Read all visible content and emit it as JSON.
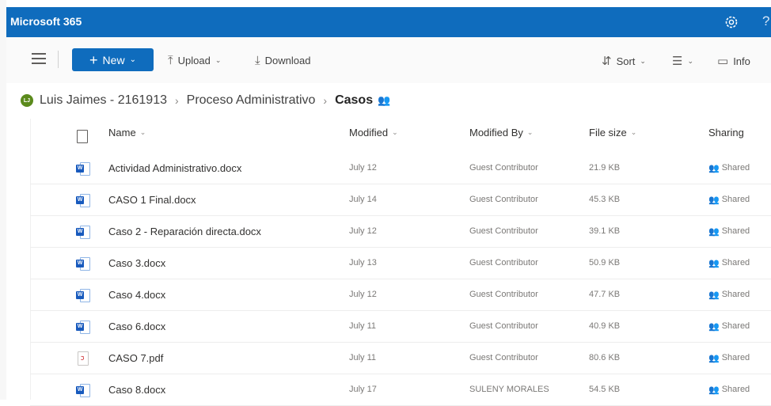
{
  "app": {
    "title": "Microsoft 365"
  },
  "toolbar": {
    "new_label": "New",
    "upload_label": "Upload",
    "download_label": "Download",
    "sort_label": "Sort",
    "info_label": "Info"
  },
  "breadcrumb": {
    "avatar_initials": "LJ",
    "items": [
      "Luis Jaimes - 2161913",
      "Proceso Administrativo",
      "Casos"
    ]
  },
  "columns": {
    "name": "Name",
    "modified": "Modified",
    "modified_by": "Modified By",
    "file_size": "File size",
    "sharing": "Sharing"
  },
  "files": [
    {
      "name": "Actividad Administrativo.docx",
      "modified": "July 12",
      "modified_by": "Guest Contributor",
      "size": "21.9 KB",
      "sharing": "Shared",
      "type": "docx"
    },
    {
      "name": "CASO 1 Final.docx",
      "modified": "July 14",
      "modified_by": "Guest Contributor",
      "size": "45.3 KB",
      "sharing": "Shared",
      "type": "docx"
    },
    {
      "name": "Caso 2 - Reparación directa.docx",
      "modified": "July 12",
      "modified_by": "Guest Contributor",
      "size": "39.1 KB",
      "sharing": "Shared",
      "type": "docx"
    },
    {
      "name": "Caso 3.docx",
      "modified": "July 13",
      "modified_by": "Guest Contributor",
      "size": "50.9 KB",
      "sharing": "Shared",
      "type": "docx"
    },
    {
      "name": "Caso 4.docx",
      "modified": "July 12",
      "modified_by": "Guest Contributor",
      "size": "47.7 KB",
      "sharing": "Shared",
      "type": "docx"
    },
    {
      "name": "Caso 6.docx",
      "modified": "July 11",
      "modified_by": "Guest Contributor",
      "size": "40.9 KB",
      "sharing": "Shared",
      "type": "docx"
    },
    {
      "name": "CASO 7.pdf",
      "modified": "July 11",
      "modified_by": "Guest Contributor",
      "size": "80.6 KB",
      "sharing": "Shared",
      "type": "pdf"
    },
    {
      "name": "Caso 8.docx",
      "modified": "July 17",
      "modified_by": "SULENY MORALES",
      "size": "54.5 KB",
      "sharing": "Shared",
      "type": "docx"
    }
  ],
  "colors": {
    "brand": "#0f6cbd",
    "avatar": "#5b8a1c",
    "word": "#185abd",
    "pdf": "#d13438"
  },
  "icons": [
    "gear-icon",
    "help-icon",
    "menu-icon",
    "plus-icon",
    "upload-icon",
    "download-icon",
    "sort-icon",
    "view-options-icon",
    "info-icon",
    "people-icon",
    "word-file-icon",
    "pdf-file-icon",
    "file-icon"
  ]
}
